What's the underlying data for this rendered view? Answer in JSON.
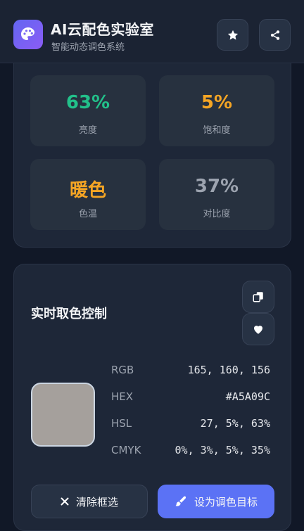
{
  "header": {
    "title": "AI云配色实验室",
    "subtitle": "智能动态调色系统",
    "logo_icon": "palette-icon",
    "star_icon": "star-icon",
    "share_icon": "share-icon"
  },
  "stats": [
    {
      "value": "63%",
      "label": "亮度",
      "color": "#22c08a"
    },
    {
      "value": "5%",
      "label": "饱和度",
      "color": "#f5a524"
    },
    {
      "value": "暖色",
      "label": "色温",
      "color": "#f5a524"
    },
    {
      "value": "37%",
      "label": "对比度",
      "color": "#9ca3af"
    }
  ],
  "control": {
    "title": "实时取色控制",
    "copy_icon": "copy-icon",
    "favorite_icon": "heart-icon",
    "swatch_color": "#A5A09C",
    "rows": [
      {
        "key": "RGB",
        "value": "165, 160, 156"
      },
      {
        "key": "HEX",
        "value": "#A5A09C"
      },
      {
        "key": "HSL",
        "value": "27, 5%, 63%"
      },
      {
        "key": "CMYK",
        "value": "0%, 3%, 5%, 35%"
      }
    ],
    "clear_label": "清除框选",
    "clear_icon": "close-icon",
    "target_label": "设为调色目标",
    "target_icon": "brush-icon"
  },
  "colors": {
    "accent": "#5b72f5",
    "background": "#111827"
  }
}
